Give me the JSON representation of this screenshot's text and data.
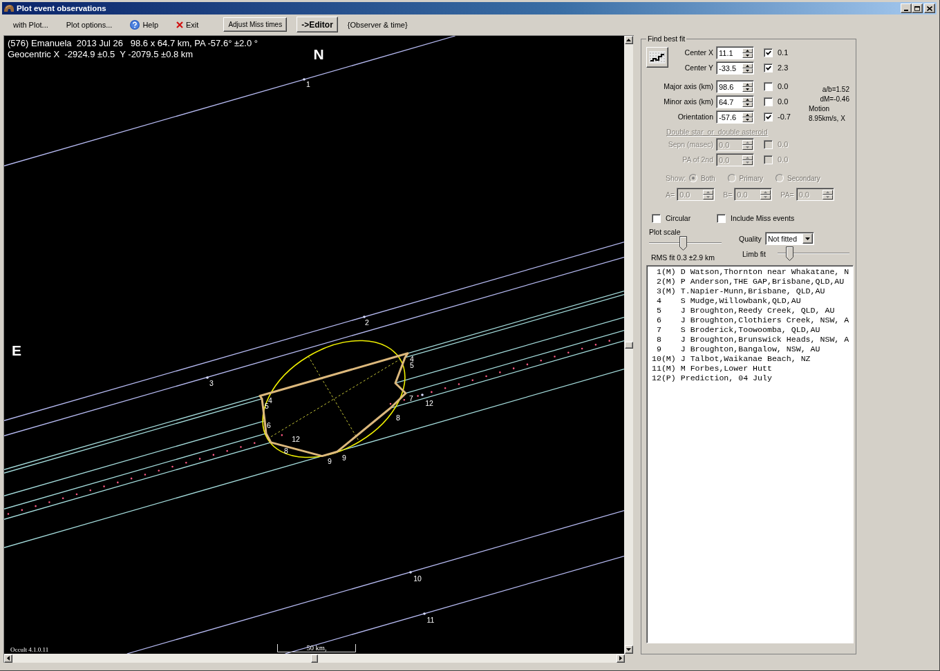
{
  "window": {
    "title": "Plot event observations"
  },
  "toolbar": [
    {
      "kind": "menu",
      "label": "with Plot..."
    },
    {
      "kind": "menu",
      "label": "Plot options..."
    },
    {
      "kind": "help",
      "label": "Help"
    },
    {
      "kind": "exit",
      "label": "Exit"
    },
    {
      "kind": "button",
      "label": "Adjust Miss times"
    },
    {
      "kind": "bold_button",
      "label": "->Editor"
    },
    {
      "kind": "label",
      "label": "{Observer & time}"
    }
  ],
  "plot": {
    "header": [
      "(576) Emanuela  2013 Jul 26   98.6 x 64.7 km, PA -57.6° ±2.0 °",
      "Geocentric X  -2924.9 ±0.5  Y -2079.5 ±0.8 km"
    ],
    "north": "N",
    "east": "E",
    "chords": [
      {
        "kind": "miss",
        "labels": [
          "1"
        ]
      },
      {
        "kind": "miss",
        "labels": [
          "2"
        ]
      },
      {
        "kind": "miss",
        "labels": [
          "3"
        ]
      },
      {
        "kind": "hit",
        "labels": [
          "4",
          "4"
        ]
      },
      {
        "kind": "hit",
        "labels": [
          "5",
          "5"
        ]
      },
      {
        "kind": "hit",
        "labels": [
          "6"
        ]
      },
      {
        "kind": "hit",
        "labels": [
          "7"
        ]
      },
      {
        "kind": "hit",
        "labels": [
          "8",
          "8"
        ]
      },
      {
        "kind": "hit",
        "labels": [
          "9",
          "9"
        ]
      },
      {
        "kind": "miss",
        "labels": [
          "10"
        ]
      },
      {
        "kind": "miss",
        "labels": [
          "11"
        ]
      },
      {
        "kind": "prediction",
        "labels": [
          "12",
          "12"
        ]
      }
    ],
    "version": "Occult 4.1.0.11",
    "scale_bar": "50 km,"
  },
  "fit_panel": {
    "title": "Find best fit",
    "params": [
      {
        "label": "Center X",
        "value": "11.1",
        "checked": true,
        "result": "0.1"
      },
      {
        "label": "Center Y",
        "value": "-33.5",
        "checked": true,
        "result": "2.3"
      },
      {
        "label": "Major axis (km)",
        "value": "98.6",
        "checked": false,
        "result": "0.0"
      },
      {
        "label": "Minor axis (km)",
        "value": "64.7",
        "checked": false,
        "result": "0.0"
      },
      {
        "label": "Orientation",
        "value": "-57.6",
        "checked": true,
        "result": "-0.7"
      }
    ],
    "stats": [
      "a/b=1.52",
      "dM=-0.46"
    ],
    "motion": [
      "Motion",
      "8.95km/s, X"
    ],
    "double_star": {
      "link": "Double star  or  double asteroid",
      "disabled": true,
      "params": [
        {
          "label": "Sepn (masec)",
          "value": "0.0",
          "checked": false,
          "result": "0.0"
        },
        {
          "label": "PA of 2nd",
          "value": "0.0",
          "checked": false,
          "result": "0.0"
        }
      ],
      "show_label": "Show:",
      "show_options": [
        {
          "label": "Both",
          "selected": true
        },
        {
          "label": "Primary",
          "selected": false
        },
        {
          "label": "Secondary",
          "selected": false
        }
      ],
      "fields": [
        {
          "label": "A=",
          "value": "0.0"
        },
        {
          "label": "B=",
          "value": "0.0"
        },
        {
          "label": "PA=",
          "value": "0.0"
        }
      ]
    },
    "options": [
      {
        "label": "Circular",
        "checked": false
      },
      {
        "label": "Include Miss events",
        "checked": false
      }
    ],
    "plot_scale": {
      "label": "Plot scale",
      "level": 0.47
    },
    "quality": {
      "label": "Quality",
      "value": "Not fitted"
    },
    "limb_fit": {
      "label": "Limb fit",
      "level": 0.13
    },
    "rms": "RMS fit 0.3 ±2.9 km",
    "observers": [
      {
        "number": "1",
        "flag": "(M)",
        "text": "D Watson,Thornton near Whakatane, N"
      },
      {
        "number": "2",
        "flag": "(M)",
        "text": "P Anderson,THE GAP,Brisbane,QLD,AU"
      },
      {
        "number": "3",
        "flag": "(M)",
        "text": "T.Napier-Munn,Brisbane, QLD,AU"
      },
      {
        "number": "4",
        "text": "S Mudge,Willowbank,QLD,AU"
      },
      {
        "number": "5",
        "text": "J Broughton,Reedy Creek, QLD, AU"
      },
      {
        "number": "6",
        "text": "J Broughton,Clothiers Creek, NSW, A"
      },
      {
        "number": "7",
        "text": "S Broderick,Toowoomba, QLD,AU"
      },
      {
        "number": "8",
        "text": "J Broughton,Brunswick Heads, NSW, A"
      },
      {
        "number": "9",
        "text": "J Broughton,Bangalow, NSW, AU"
      },
      {
        "number": "10",
        "flag": "(M)",
        "text": "J Talbot,Waikanae Beach, NZ"
      },
      {
        "number": "11",
        "flag": "(M)",
        "text": "M Forbes,Lower Hutt"
      },
      {
        "number": "12",
        "flag": "(P)",
        "text": "Prediction, 04 July"
      }
    ]
  }
}
